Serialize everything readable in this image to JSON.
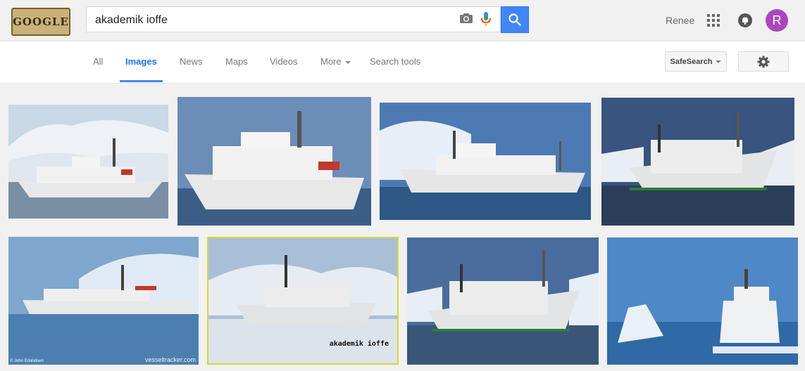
{
  "header": {
    "logo_text": "GOOGLE",
    "query": "akademik ioffe",
    "user_name": "Renee",
    "avatar_letter": "R"
  },
  "nav": {
    "tabs": [
      "All",
      "Images",
      "News",
      "Maps",
      "Videos",
      "More",
      "Search tools"
    ],
    "active_tab": "Images",
    "safesearch_label": "SafeSearch"
  },
  "results": {
    "captions": {
      "watermark_5": "vesseltracker.com",
      "credit_5": "© John Erlandsen",
      "caption_6": "akademik ioffe"
    }
  },
  "colors": {
    "accent": "#4285f4",
    "avatar": "#ab47bc",
    "tab_active": "#1a73e8"
  }
}
